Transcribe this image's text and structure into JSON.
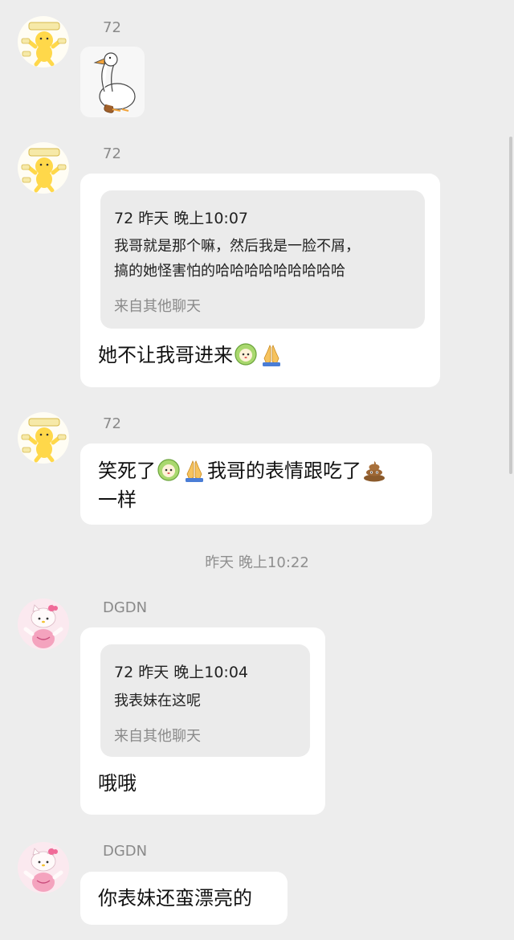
{
  "messages": [
    {
      "sender": "72",
      "type": "sticker",
      "sticker": "white-goose-sticker"
    },
    {
      "sender": "72",
      "quote": {
        "header": "72 昨天 晚上10:07",
        "line1": "我哥就是那个嘛，然后我是一脸不屑，",
        "line2": "搞的她怪害怕的哈哈哈哈哈哈哈哈哈",
        "source": "来自其他聊天"
      },
      "text": "她不让我哥进来"
    },
    {
      "sender": "72",
      "text_part1": "笑死了",
      "text_part2": "我哥的表情跟吃了",
      "text_part3": "一样"
    },
    {
      "sender": "DGDN",
      "quote": {
        "header": "72 昨天 晚上10:04",
        "line1": "我表妹在这呢",
        "source": "来自其他聊天"
      },
      "text": "哦哦"
    },
    {
      "sender": "DGDN",
      "text": "你表妹还蛮漂亮的"
    }
  ],
  "timestamp": "昨天 晚上10:22",
  "avatar_labels": {
    "yellow_sign": "可以你最一生漂"
  },
  "colors": {
    "background": "#ededed",
    "bubble": "#ffffff",
    "quote": "#ebebeb",
    "muted_text": "#8a8a8a"
  },
  "icons": [
    "yellow-duck-avatar",
    "hello-kitty-avatar",
    "cabbage-dog-emoji",
    "folded-hands-emoji",
    "poop-emoji",
    "white-goose-sticker"
  ]
}
